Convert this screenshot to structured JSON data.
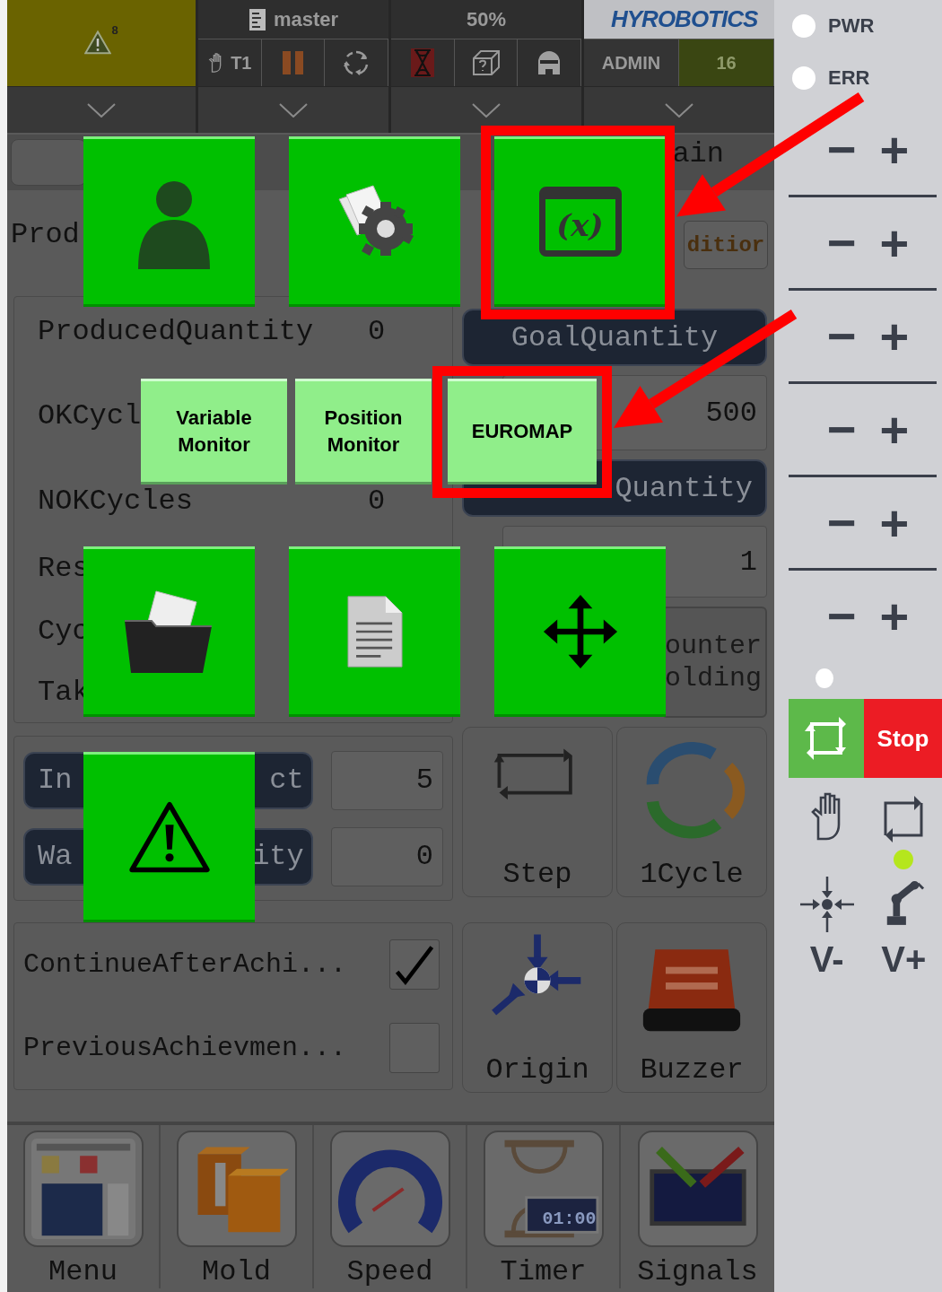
{
  "top_bar": {
    "alarm_count": "8",
    "program": "master",
    "mode": "T1",
    "speed": "50%",
    "logo": "HYROBOTICS",
    "user": "ADMIN",
    "user_level": "16"
  },
  "tab_row": {
    "label": "ain"
  },
  "header_row": {
    "label": "Prod",
    "condition_button": "ditior"
  },
  "counters": [
    {
      "label": "ProducedQuantity",
      "value": "0"
    },
    {
      "label": "OKCycl"
    },
    {
      "label": "NOKCycles",
      "value": "0"
    },
    {
      "label": "Res"
    },
    {
      "label": "Cyc"
    },
    {
      "label": "Tak"
    }
  ],
  "quantity_rows": [
    {
      "button_start": "In",
      "button_end": "ct",
      "value": "5"
    },
    {
      "button_start": "Wa",
      "button_end": "ity",
      "value": "0"
    }
  ],
  "goal": {
    "goal_button": "GoalQuantity",
    "goal_value": "500",
    "cavity_button": "Quantity",
    "cavity_value": "1",
    "counter_lines": [
      "ounter",
      "olding"
    ]
  },
  "run_buttons": [
    {
      "kind": "step",
      "label": "Step"
    },
    {
      "kind": "cycle",
      "label": "1Cycle"
    }
  ],
  "options": [
    {
      "label": "ContinueAfterAchi...",
      "checked": true
    },
    {
      "label": "PreviousAchievmen...",
      "checked": false
    }
  ],
  "tool_buttons": [
    {
      "kind": "origin",
      "label": "Origin"
    },
    {
      "kind": "buzzer",
      "label": "Buzzer"
    }
  ],
  "nav": [
    {
      "kind": "menu",
      "label": "Menu"
    },
    {
      "kind": "mold",
      "label": "Mold"
    },
    {
      "kind": "speed",
      "label": "Speed"
    },
    {
      "kind": "timer",
      "label": "Timer",
      "display": "01:00"
    },
    {
      "kind": "signals",
      "label": "Signals"
    }
  ],
  "popup": {
    "tiles": [
      {
        "kind": "user",
        "highlighted": false
      },
      {
        "kind": "settings",
        "highlighted": false
      },
      {
        "kind": "variable",
        "glyph": "(x)",
        "highlighted": true
      },
      {
        "kind": "folder",
        "highlighted": false
      },
      {
        "kind": "document",
        "highlighted": false
      },
      {
        "kind": "move",
        "highlighted": false
      },
      {
        "kind": "warning",
        "highlighted": false
      }
    ],
    "monitor_buttons": [
      {
        "label": "Variable Monitor",
        "highlighted": false
      },
      {
        "label": "Position Monitor",
        "highlighted": false
      },
      {
        "label": "EUROMAP",
        "highlighted": true
      }
    ]
  },
  "side_panel": {
    "leds": [
      {
        "label": "PWR",
        "lit": false
      },
      {
        "label": "ERR",
        "lit": false
      }
    ],
    "jog_rows": [
      {
        "minus": "−",
        "plus": "+"
      },
      {
        "minus": "−",
        "plus": "+"
      },
      {
        "minus": "−",
        "plus": "+"
      },
      {
        "minus": "−",
        "plus": "+"
      },
      {
        "minus": "−",
        "plus": "+"
      },
      {
        "minus": "−",
        "plus": "+"
      }
    ],
    "stop": "Stop",
    "run_indicator_lit": true,
    "speed_down": "V-",
    "speed_up": "V+"
  }
}
